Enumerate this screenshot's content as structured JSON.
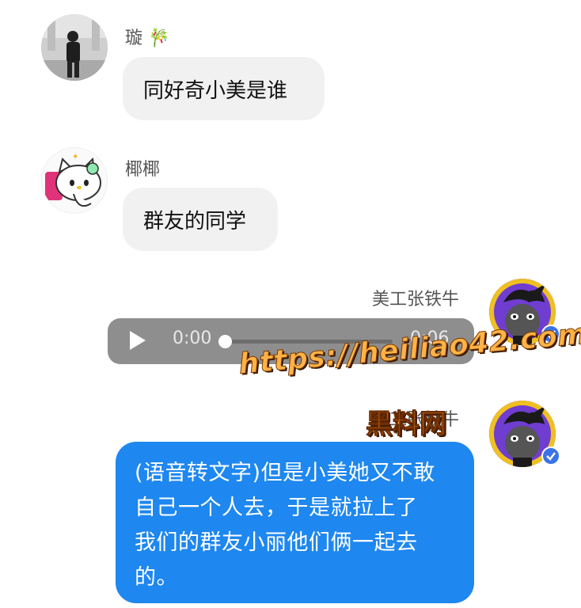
{
  "messages": [
    {
      "sender": "璇",
      "sender_emoji": "🎋",
      "text": "同好奇小美是谁"
    },
    {
      "sender": "椰椰",
      "text": "群友的同学"
    },
    {
      "sender": "美工张铁牛",
      "audio": {
        "elapsed": "0:00",
        "remaining": "-0:06",
        "progress": 0
      }
    },
    {
      "sender": "美工张铁牛",
      "text": "(语音转文字)但是小美她又不敢自己一个人去，于是就拉上了我们的群友小丽他们俩一起去的。",
      "lines": [
        "(语音转文字)但是小美她又不敢",
        "自己一个人去，于是就拉上了",
        "我们的群友小丽他们俩一起去",
        "的。"
      ]
    }
  ],
  "watermark": {
    "url": "https://heiliao42.com",
    "site_name": "黑料网"
  },
  "colors": {
    "outgoing_bubble": "#1e87f0",
    "incoming_bubble": "#f1f1f1",
    "audio_bubble": "#8e8e8e",
    "verified_badge": "#3a73e8"
  }
}
